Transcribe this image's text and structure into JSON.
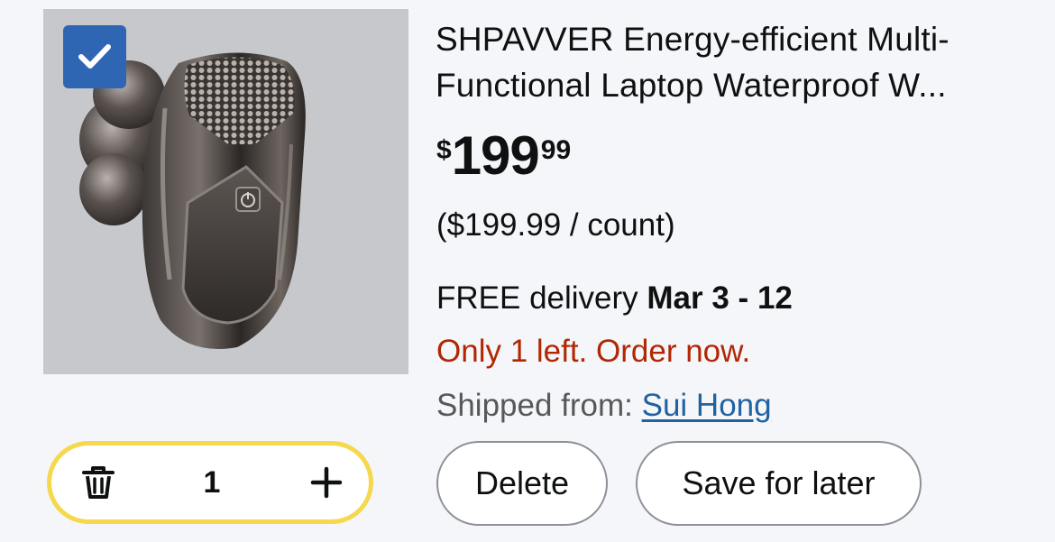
{
  "item": {
    "title": "SHPAVVER Energy-efficient Multi-Functional Laptop Waterproof W...",
    "selected": true,
    "price": {
      "symbol": "$",
      "whole": "199",
      "fraction": "99"
    },
    "unit_price": "($199.99 / count)",
    "delivery": {
      "prefix": "FREE delivery ",
      "dates": "Mar 3 - 12"
    },
    "stock": "Only 1 left. Order now.",
    "shipped": {
      "prefix": "Shipped from: ",
      "seller": "Sui Hong"
    }
  },
  "quantity": {
    "value": "1"
  },
  "actions": {
    "delete_label": "Delete",
    "save_label": "Save for later"
  },
  "colors": {
    "checkbox": "#2f66b3",
    "stock_red": "#b12704",
    "link_blue": "#2162a1",
    "stepper_border": "#f5d84b"
  },
  "icons": [
    "checkmark-icon",
    "trash-icon",
    "plus-icon"
  ]
}
